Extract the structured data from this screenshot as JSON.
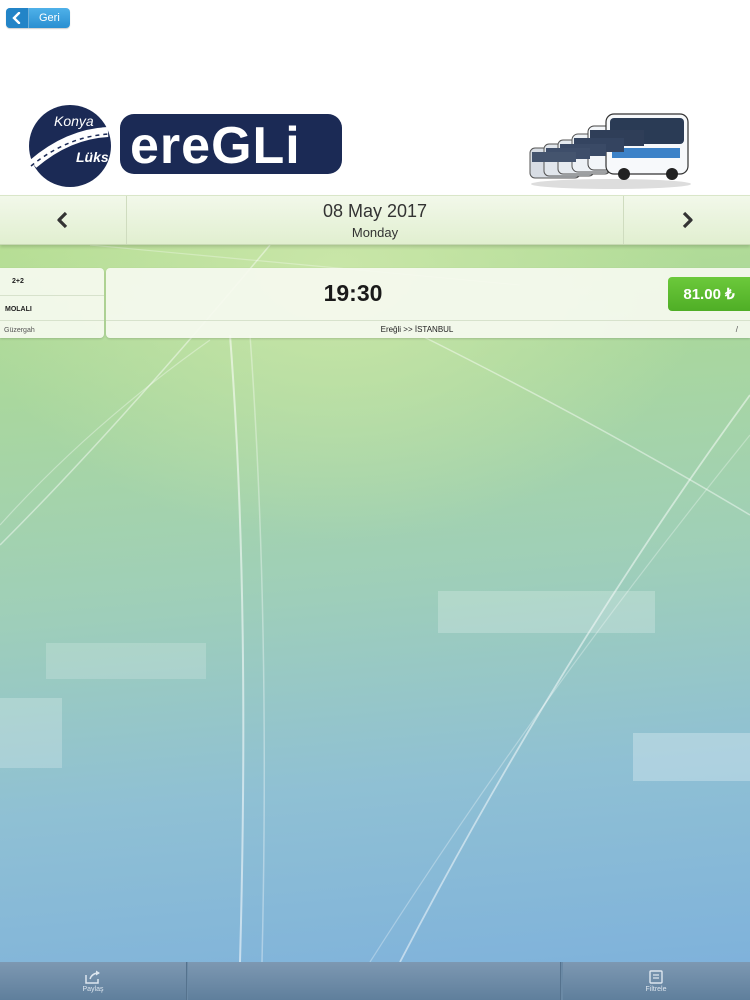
{
  "header": {
    "back_label": "Geri",
    "logo": {
      "line1": "Konya",
      "line2": "Lüks",
      "brand": "ereGLi"
    }
  },
  "date_nav": {
    "date": "08 May 2017",
    "weekday": "Monday"
  },
  "trip": {
    "seat_layout": "2+2",
    "break_label": "MOLALI",
    "route_label": "Güzergah",
    "time": "19:30",
    "price": "81.00 ₺",
    "route": "Ereğli >> İSTANBUL",
    "info_mark": "/"
  },
  "bottom_bar": {
    "share_label": "Paylaş",
    "filter_label": "Filtrele"
  },
  "colors": {
    "back_button": "#2a8fd1",
    "price_tag": "#58b82e",
    "logo_navy": "#1b2a55",
    "bottom_bar": "#6b8aa6"
  }
}
